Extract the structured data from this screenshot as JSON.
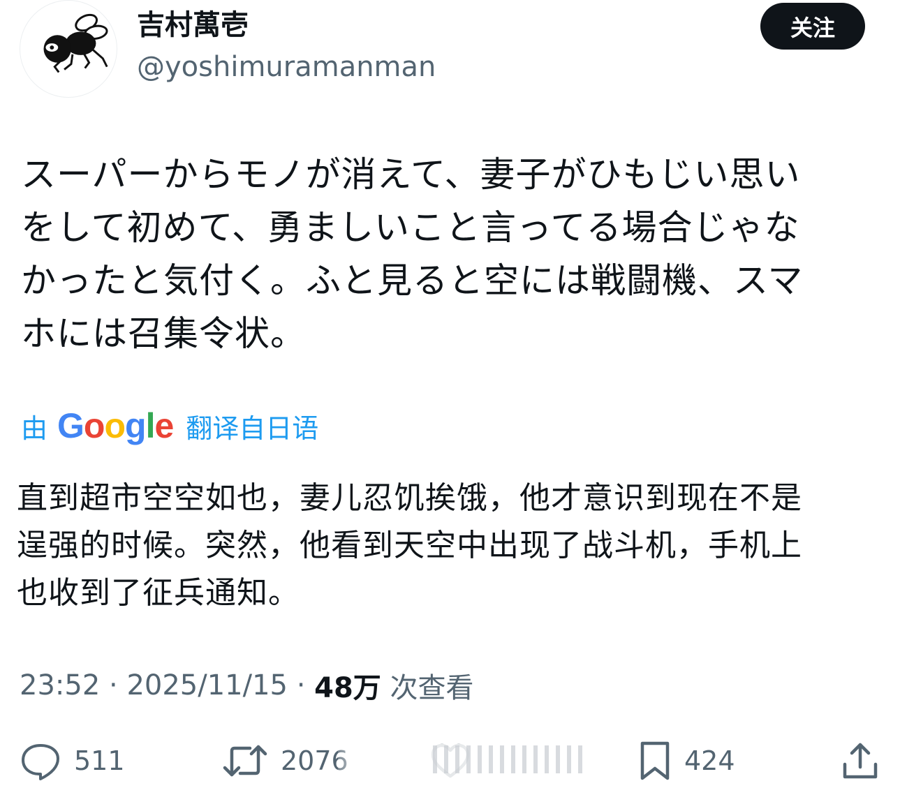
{
  "user": {
    "display_name": "吉村萬壱",
    "handle": "@yoshimuramanman",
    "avatar_icon": "fly-drawing-icon"
  },
  "follow_button": {
    "label": "关注"
  },
  "tweet": {
    "text": "スーパーからモノが消えて、妻子がひもじい思い\nをして初めて、勇ましいこと言ってる場合じゃな\nかったと気付く。ふと見ると空には戦闘機、スマ\nホには召集令状。"
  },
  "translation": {
    "prefix": "由",
    "logo": {
      "g": "G",
      "o1": "o",
      "o2": "o",
      "g2": "g",
      "l": "l",
      "e": "e"
    },
    "suffix": "翻译自日语",
    "text": "直到超市空空如也，妻儿忍饥挨饿，他才意识到现在不是\n逞强的时候。突然，他看到天空中出现了战斗机，手机上\n也收到了征兵通知。"
  },
  "meta": {
    "time": "23:52",
    "sep1": " · ",
    "date": "2025/11/15",
    "sep2": " · ",
    "views_count": "48万",
    "views_label": " 次查看"
  },
  "actions": {
    "reply": {
      "icon": "reply-icon",
      "count": "511"
    },
    "retweet": {
      "icon": "retweet-icon",
      "count": "2076"
    },
    "like": {
      "icon": "like-icon"
    },
    "bookmark": {
      "icon": "bookmark-icon",
      "count": "424"
    },
    "share": {
      "icon": "share-icon"
    }
  },
  "colors": {
    "text_primary": "#0f1419",
    "text_secondary": "#536471",
    "link_blue": "#1d9bf0",
    "follow_bg": "#0f1419"
  }
}
